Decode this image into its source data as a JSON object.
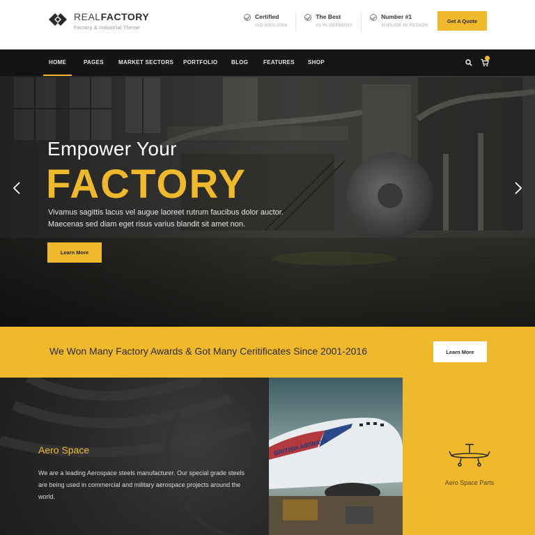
{
  "brand": {
    "name_light": "REAL",
    "name_bold": "FACTORY",
    "tagline": "Factory & Industrial Theme"
  },
  "header_info": [
    {
      "title": "Certified",
      "sub": "ISO 9001:2008",
      "icon": "check-circle-icon"
    },
    {
      "title": "The Best",
      "sub": "#1 IN GERMANY",
      "icon": "check-circle-icon"
    },
    {
      "title": "Number #1",
      "sub": "SUPLIER IN REGION",
      "icon": "check-circle-icon"
    }
  ],
  "quote_button": "Get A Quote",
  "nav": {
    "items": [
      "HOME",
      "PAGES",
      "MARKET SECTORS",
      "PORTFOLIO",
      "BLOG",
      "FEATURES",
      "SHOP"
    ],
    "active": "HOME",
    "icons": [
      "search-icon",
      "cart-icon"
    ]
  },
  "hero": {
    "pre_title": "Empower Your",
    "title": "FACTORY",
    "description": "Vivamus sagittis lacus vel augue laoreet rutrum faucibus dolor auctor. Maecenas sed diam eget risus varius blandit sit amet non.",
    "button": "Learn More"
  },
  "awards": {
    "text": "We Won Many Factory Awards & Got Many Ceritificates Since 2001-2016",
    "button": "Learn More"
  },
  "sector": {
    "title": "Aero Space",
    "description": "We are a leading Aerospace steels manufacturer. Our special grade steels are being used in commercial and military aerospace projects around the world.",
    "card_label": "Aero Space Parts",
    "photo_text": "BRITISH AIRWAYS"
  },
  "colors": {
    "accent": "#f0b92c",
    "dark": "#1d1d1d",
    "nav": "#121212"
  }
}
